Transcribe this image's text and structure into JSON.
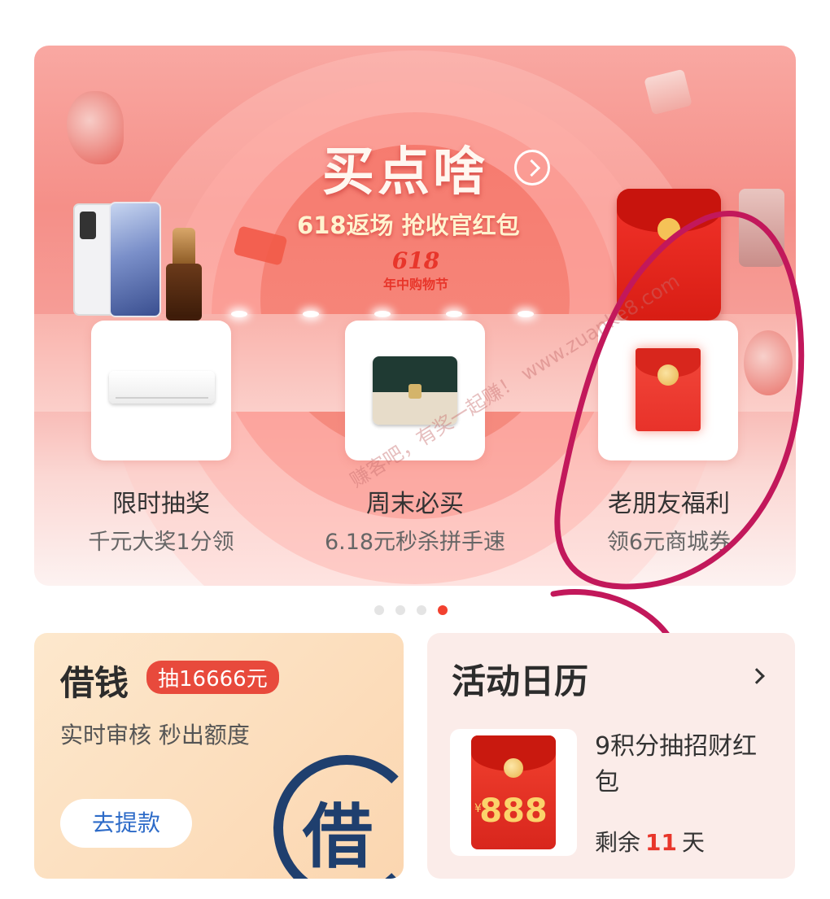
{
  "banner": {
    "title": "买点啥",
    "subtitle": "618返场 抢收官红包",
    "logo_number": "618",
    "logo_text": "年中购物节",
    "tiles": [
      {
        "label": "限时抽奖",
        "sub": "千元大奖1分领",
        "icon": "air-conditioner"
      },
      {
        "label": "周末必买",
        "sub": "6.18元秒杀拼手速",
        "icon": "handbag"
      },
      {
        "label": "老朋友福利",
        "sub": "领6元商城券",
        "icon": "red-envelope"
      }
    ],
    "watermark": "赚客吧，有奖一起赚！ www.zuanke8.com"
  },
  "pagination": {
    "count": 4,
    "active_index": 3
  },
  "loan_card": {
    "title": "借钱",
    "badge": "抽16666元",
    "desc": "实时审核 秒出额度",
    "button": "去提款",
    "stamp_char": "借"
  },
  "calendar_card": {
    "title": "活动日历",
    "item_title": "9积分抽招财红包",
    "envelope_amount": "888",
    "envelope_currency": "¥",
    "remain_prefix": "剩余",
    "remain_days": "11",
    "remain_suffix": "天"
  },
  "colors": {
    "accent_red": "#e8362b",
    "annotation_pink": "#c2185b",
    "link_blue": "#2d6bc8"
  }
}
